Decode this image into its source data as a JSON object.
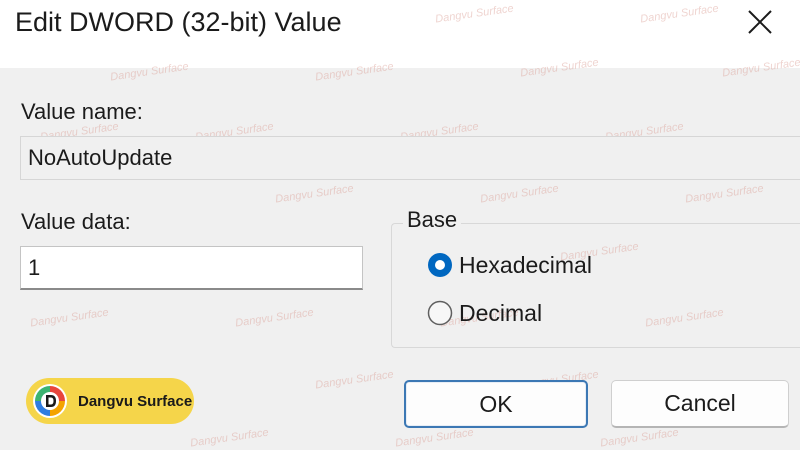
{
  "dialog": {
    "title": "Edit DWORD (32-bit) Value",
    "close_icon": "close-icon"
  },
  "value_name": {
    "label": "Value name:",
    "value": "NoAutoUpdate"
  },
  "value_data": {
    "label": "Value data:",
    "value": "1"
  },
  "base": {
    "legend": "Base",
    "options": [
      {
        "label": "Hexadecimal",
        "selected": true
      },
      {
        "label": "Decimal",
        "selected": false
      }
    ]
  },
  "buttons": {
    "ok": "OK",
    "cancel": "Cancel"
  },
  "badge": {
    "text": "Dangvu Surface",
    "logo_icon": "dangvu-logo-icon"
  },
  "watermark_text": "Dangvu Surface",
  "colors": {
    "accent": "#0067c0",
    "badge_bg": "#f5d54a",
    "client_bg": "#f0f0f0",
    "ok_border": "#3c78b4"
  }
}
